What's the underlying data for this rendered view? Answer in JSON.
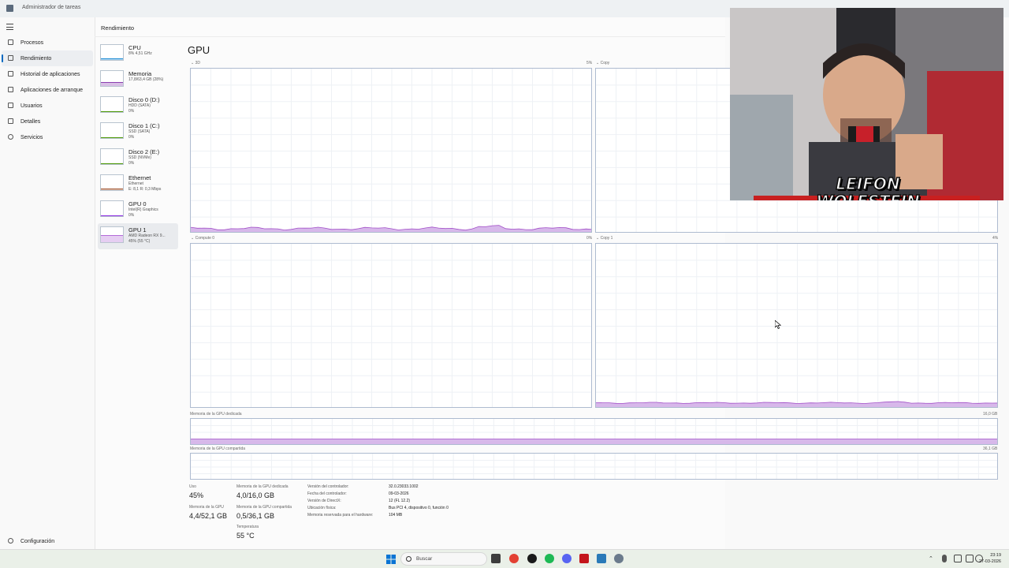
{
  "window": {
    "title": "Administrador de tareas"
  },
  "nav": {
    "items": [
      {
        "label": "Procesos",
        "icon": "processes-icon"
      },
      {
        "label": "Rendimiento",
        "icon": "performance-icon",
        "active": true
      },
      {
        "label": "Historial de aplicaciones",
        "icon": "history-icon"
      },
      {
        "label": "Aplicaciones de arranque",
        "icon": "startup-icon"
      },
      {
        "label": "Usuarios",
        "icon": "users-icon"
      },
      {
        "label": "Detalles",
        "icon": "details-icon"
      },
      {
        "label": "Servicios",
        "icon": "services-icon"
      }
    ],
    "settings": "Configuración"
  },
  "header": {
    "title": "Rendimiento"
  },
  "perf_list": [
    {
      "name": "CPU",
      "sub": [
        "8% 4,51 GHz"
      ],
      "color": "#1a8ad4",
      "level": 0.08
    },
    {
      "name": "Memoria",
      "sub": [
        "17,8/63,4 GB (28%)"
      ],
      "color": "#8b3fb0",
      "level": 0.28
    },
    {
      "name": "Disco 0 (D:)",
      "sub": [
        "HDD (SATA)",
        "0%"
      ],
      "color": "#4e9a06",
      "level": 0
    },
    {
      "name": "Disco 1 (C:)",
      "sub": [
        "SSD (SATA)",
        "0%"
      ],
      "color": "#4e9a06",
      "level": 0
    },
    {
      "name": "Disco 2 (E:)",
      "sub": [
        "SSD (NVMe)",
        "0%"
      ],
      "color": "#4e9a06",
      "level": 0
    },
    {
      "name": "Ethernet",
      "sub": [
        "Ethernet",
        "E: 8,1 R: 0,3 Mbps"
      ],
      "color": "#a0522d",
      "level": 0.1
    },
    {
      "name": "GPU 0",
      "sub": [
        "Intel(R) Graphics",
        "0%"
      ],
      "color": "#8a2be2",
      "level": 0
    },
    {
      "name": "GPU 1",
      "sub": [
        "AMD Radeon RX 9...",
        "45% (55 °C)"
      ],
      "color": "#b36bd8",
      "level": 0.45,
      "selected": true
    }
  ],
  "gpu": {
    "title": "GPU",
    "engines": [
      {
        "name": "3D",
        "value": "5%"
      },
      {
        "name": "Copy",
        "value": ""
      },
      {
        "name": "Compute 0",
        "value": "0%"
      },
      {
        "name": "Copy 1",
        "value": "4%"
      }
    ],
    "dedicated_label": "Memoria de la GPU dedicada",
    "dedicated_max": "16,0 GB",
    "dedicated_level": 0.25,
    "shared_label": "Memoria de la GPU compartida",
    "shared_max": "36,1 GB",
    "shared_level": 0.014
  },
  "stats": {
    "uso_label": "Uso",
    "uso_value": "45%",
    "dedicada_label": "Memoria de la GPU dedicada",
    "dedicada_value": "4,0/16,0 GB",
    "mem_gpu_label": "Memoria de la GPU",
    "mem_gpu_value": "4,4/52,1 GB",
    "compartida_label": "Memoria de la GPU compartida",
    "compartida_value": "0,5/36,1 GB",
    "temp_label": "Temperatura",
    "temp_value": "55 °C"
  },
  "info": [
    {
      "label": "Versión del controlador:",
      "value": "32.0.23033.1002"
    },
    {
      "label": "Fecha del controlador:",
      "value": "09-03-2026"
    },
    {
      "label": "Versión de DirectX:",
      "value": "12 (FL 12.2)"
    },
    {
      "label": "Ubicación física:",
      "value": "Bus PCI 4, dispositivo 0, función 0"
    },
    {
      "label": "Memoria reservada para el hardware:",
      "value": "104 MB"
    }
  ],
  "webcam": {
    "overlay": "LEIFON WOLFSTEIN"
  },
  "taskbar": {
    "search_placeholder": "Buscar",
    "time": "23:19",
    "date": "27-03-2026"
  },
  "colors": {
    "gpu_accent": "#a24fc8",
    "gpu_fill": "#d7b8ea",
    "graph_border": "#aebbd0",
    "grid": "#eef1f5"
  }
}
